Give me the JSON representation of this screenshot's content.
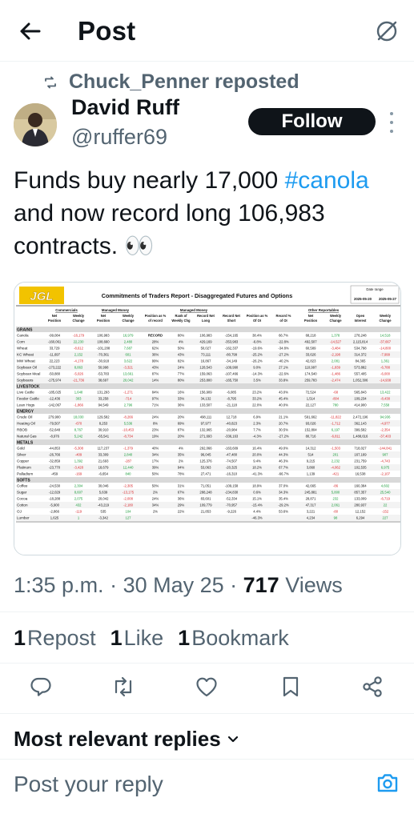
{
  "header": {
    "title": "Post",
    "back_icon": "arrow-left-icon",
    "grok_icon": "grok-icon"
  },
  "repost": {
    "text": "Chuck_Penner reposted"
  },
  "author": {
    "name": "David Ruff",
    "handle": "@ruffer69",
    "follow_label": "Follow"
  },
  "post": {
    "text_before": "Funds buy nearly 17,000",
    "hashtag": "#canola",
    "text_after": "and now record long 106,983 contracts.",
    "emoji": "👀"
  },
  "media": {
    "logo": "JGL",
    "title": "Commitments of Traders Report - Disaggregated Futures and Options",
    "date_label": "Date range",
    "date_from": "2025-05-20",
    "date_to": "2025-05-27",
    "groups": [
      "Commercials",
      "Managed Money",
      "Managed Money",
      "Other Reportables"
    ],
    "columns": [
      "Net Position",
      "Weekly Change",
      "Net Position",
      "Weekly Change",
      "Position as % of record",
      "Rank of Weekly Chg",
      "Record Net Long",
      "Record Net Short",
      "Position as % Of OI",
      "Record % of OI",
      "Net Position",
      "Weekly Change",
      "Open Interest",
      "Weekly Change"
    ],
    "sections": [
      {
        "name": "GRAINS",
        "rows": [
          [
            "Canola",
            "-99,084",
            "-16,179",
            "106,983",
            "16,979",
            "RECORD",
            "80%",
            "106,983",
            "-154,165",
            "38.4%",
            "66.7%",
            "68,218",
            "1,378",
            "278,248",
            "14,518"
          ],
          [
            "Corn",
            "-160,061",
            "22,230",
            "108,660",
            "2,480",
            "28%",
            "4%",
            "429,169",
            "-353,983",
            "-6.8%",
            "-22.8%",
            "492,507",
            "-14,527",
            "2,115,814",
            "-37,667"
          ],
          [
            "Wheat",
            "33,729",
            "-8,612",
            "-101,208",
            "7,687",
            "62%",
            "50%",
            "50,027",
            "-162,337",
            "-19.6%",
            "-34.8%",
            "60,589",
            "-3,484",
            "534,798",
            "-14,800"
          ],
          [
            "KC Wheat",
            "-11,697",
            "2,152",
            "-70,361",
            "601",
            "36%",
            "43%",
            "73,111",
            "-80,799",
            "-25.2%",
            "-27.2%",
            "33,626",
            "-2,198",
            "314,372",
            "-7,999"
          ],
          [
            "MW Wheat",
            "22,223",
            "-4,178",
            "-30,918",
            "3,622",
            "99%",
            "82%",
            "16,867",
            "-34,149",
            "-26.2%",
            "-40.2%",
            "42,823",
            "2,081",
            "84,365",
            "1,361"
          ],
          [
            "Soybean Oil",
            "-173,222",
            "8,863",
            "50,998",
            "-3,321",
            "43%",
            "24%",
            "128,543",
            "-109,990",
            "9.0%",
            "27.1%",
            "110,997",
            "-1,839",
            "573,882",
            "-6,788"
          ],
          [
            "Soybean Meal",
            "-50,880",
            "-5,026",
            "-53,783",
            "13,661",
            "87%",
            "77%",
            "159,063",
            "-107,466",
            "-14.3%",
            "-22.6%",
            "174,540",
            "-1,486",
            "557,405",
            "-6,000"
          ],
          [
            "Soybeans",
            "-175,974",
            "-21,736",
            "38,697",
            "20,042",
            "14%",
            "80%",
            "253,800",
            "-165,750",
            "3.5%",
            "33.8%",
            "259,783",
            "-2,474",
            "1,052,306",
            "-14,938"
          ]
        ]
      },
      {
        "name": "LIVESTOCK",
        "rows": [
          [
            "Live Cattle",
            "-185,025",
            "1,648",
            "131,293",
            "-1,271",
            "84%",
            "16%",
            "156,909",
            "-6,085",
            "23.2%",
            "43.0%",
            "72,524",
            "-68",
            "565,843",
            "13,422"
          ],
          [
            "Feeder Cattle",
            "-12,436",
            "303",
            "33,258",
            "-714",
            "97%",
            "33%",
            "34,132",
            "-8,795",
            "33.2%",
            "45.4%",
            "1,514",
            "-804",
            "109,234",
            "-8,438"
          ],
          [
            "Lean Hogs",
            "-142,067",
            "-1,866",
            "94,549",
            "2,796",
            "71%",
            "36%",
            "133,507",
            "-21,118",
            "22.0%",
            "40.0%",
            "22,127",
            "780",
            "414,900",
            "7,558"
          ]
        ]
      },
      {
        "name": "ENERGY",
        "rows": [
          [
            "Crude Oil",
            "279,900",
            "18,030",
            "129,582",
            "-8,266",
            "24%",
            "20%",
            "498,111",
            "12,718",
            "6.9%",
            "21.1%",
            "591,662",
            "-11,822",
            "2,472,196",
            "94,936"
          ],
          [
            "Heating Oil",
            "-79,507",
            "-670",
            "8,253",
            "5,536",
            "8%",
            "69%",
            "97,977",
            "-40,823",
            "2.3%",
            "20.7%",
            "93,026",
            "-1,712",
            "362,143",
            "-4,977"
          ],
          [
            "RBOB",
            "-52,648",
            "8,767",
            "30,910",
            "-10,453",
            "23%",
            "87%",
            "132,965",
            "-20,984",
            "7.7%",
            "30.5%",
            "152,804",
            "6,197",
            "399,582",
            "-2,354"
          ],
          [
            "Natural Gas",
            "-8,976",
            "5,242",
            "-65,541",
            "-8,734",
            "19%",
            "20%",
            "271,693",
            "-336,163",
            "-4.3%",
            "-27.2%",
            "80,716",
            "-6,811",
            "1,488,616",
            "-37,403"
          ]
        ]
      },
      {
        "name": "METALS",
        "rows": [
          [
            "Gold",
            "-44,853",
            "-5,308",
            "117,237",
            "-1,379",
            "40%",
            "4%",
            "292,066",
            "-163,609",
            "16.4%",
            "49.0%",
            "14,312",
            "-1,503",
            "718,027",
            "-144,841"
          ],
          [
            "Silver",
            "-26,766",
            "-409",
            "33,309",
            "2,840",
            "34%",
            "35%",
            "96,045",
            "-47,480",
            "20.0%",
            "44.3%",
            "514",
            "201",
            "167,169",
            "907"
          ],
          [
            "Copper",
            "-32,859",
            "1,392",
            "21,693",
            "-287",
            "17%",
            "2%",
            "125,376",
            "-74,507",
            "9.4%",
            "46.3%",
            "9,215",
            "2,232",
            "231,759",
            "-4,743"
          ],
          [
            "Platinum",
            "-23,770",
            "-3,428",
            "18,679",
            "12,440",
            "39%",
            "94%",
            "53,063",
            "-20,325",
            "18.2%",
            "67.7%",
            "3,860",
            "-4,062",
            "102,535",
            "6,975"
          ],
          [
            "Palladium",
            "-459",
            "-169",
            "-6,654",
            "840",
            "50%",
            "78%",
            "27,471",
            "-16,310",
            "-41.3%",
            "-66.7%",
            "1,139",
            "-421",
            "16,538",
            "-2,107"
          ]
        ]
      },
      {
        "name": "SOFTS",
        "rows": [
          [
            "Coffee",
            "-24,530",
            "2,304",
            "30,046",
            "-2,305",
            "50%",
            "31%",
            "71,051",
            "-109,158",
            "18.9%",
            "37.0%",
            "42,665",
            "-86",
            "160,384",
            "4,602"
          ],
          [
            "Sugar",
            "-12,029",
            "8,607",
            "5,639",
            "-13,175",
            "2%",
            "67%",
            "288,248",
            "-234,830",
            "0.6%",
            "34.3%",
            "245,881",
            "5,800",
            "857,357",
            "25,540"
          ],
          [
            "Cocoa",
            "-18,288",
            "2,075",
            "20,042",
            "-2,008",
            "24%",
            "36%",
            "83,601",
            "-52,334",
            "15.1%",
            "35.4%",
            "28,871",
            "232",
            "133,009",
            "-6,719"
          ],
          [
            "Cotton",
            "-5,900",
            "432",
            "-43,219",
            "-2,180",
            "34%",
            "29%",
            "109,779",
            "-70,957",
            "-15.4%",
            "-29.2%",
            "47,317",
            "2,061",
            "280,937",
            "22"
          ],
          [
            "OJ",
            "-2,866",
            "-119",
            "535",
            "104",
            "2%",
            "22%",
            "21,853",
            "-9,226",
            "4.4%",
            "53.6%",
            "3,221",
            "-80",
            "12,152",
            "-152"
          ],
          [
            "Lumber",
            "1,625",
            "1",
            "-3,342",
            "127",
            "",
            "",
            "",
            "",
            "-46.3%",
            "",
            "4,234",
            "98",
            "6,294",
            "227"
          ]
        ]
      }
    ]
  },
  "meta": {
    "time": "1:35 p.m.",
    "date": "30 May 25",
    "views_count": "717",
    "views_label": "Views"
  },
  "stats": {
    "reposts_count": "1",
    "reposts_label": "Repost",
    "likes_count": "1",
    "likes_label": "Like",
    "bookmarks_count": "1",
    "bookmarks_label": "Bookmark"
  },
  "replies": {
    "heading": "Most relevant replies",
    "reply_placeholder": "Post your reply"
  },
  "colors": {
    "accent": "#1d9bf0",
    "text": "#0f1419",
    "muted": "#536471",
    "positive": "#1a9c3a",
    "negative": "#d9262a"
  }
}
